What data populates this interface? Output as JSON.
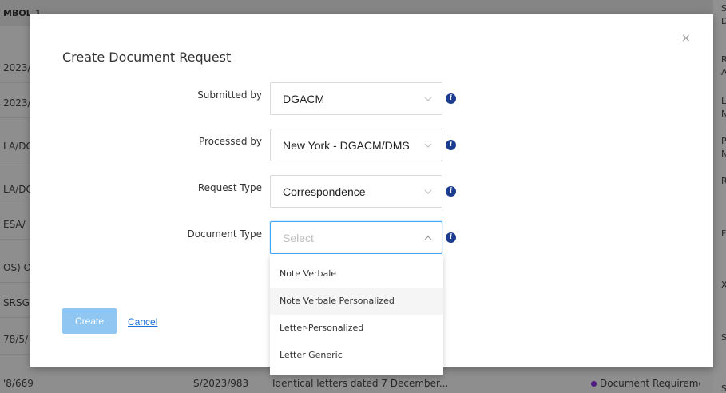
{
  "background": {
    "header_fragment": "MBOL 1",
    "left_fragments": [
      "2023/",
      "2023/",
      "LA/DC",
      "LA/DC",
      "ESA/",
      "OS) O",
      "SRSG",
      "78/5/"
    ],
    "bottom_row": {
      "symbol": "'8/669",
      "document": "S/2023/983",
      "title": "Identical letters dated 7 December...",
      "status": "Document Requireme"
    },
    "right_fragments": [
      "S",
      "D",
      "R",
      "A",
      "L",
      "N",
      "P",
      "N",
      "R",
      "F",
      "X",
      "S",
      "S"
    ]
  },
  "modal": {
    "title": "Create Document Request",
    "close_label": "×",
    "fields": [
      {
        "label": "Submitted by",
        "value": "DGACM",
        "placeholder": false
      },
      {
        "label": "Processed by",
        "value": "New York - DGACM/DMS",
        "placeholder": false
      },
      {
        "label": "Request Type",
        "value": "Correspondence",
        "placeholder": false
      },
      {
        "label": "Document Type",
        "value": "Select",
        "placeholder": true
      }
    ],
    "dropdown_options": [
      "Note Verbale",
      "Note Verbale Personalized",
      "Letter-Personalized",
      "Letter Generic"
    ],
    "create_label": "Create",
    "cancel_label": "Cancel",
    "info_glyph": "i"
  },
  "colors": {
    "accent": "#1890ff",
    "create_button_disabled": "#8fc7f2",
    "info_icon": "#1c3d8f",
    "link": "#1d6fd8",
    "status_dot": "#8a2be2"
  }
}
